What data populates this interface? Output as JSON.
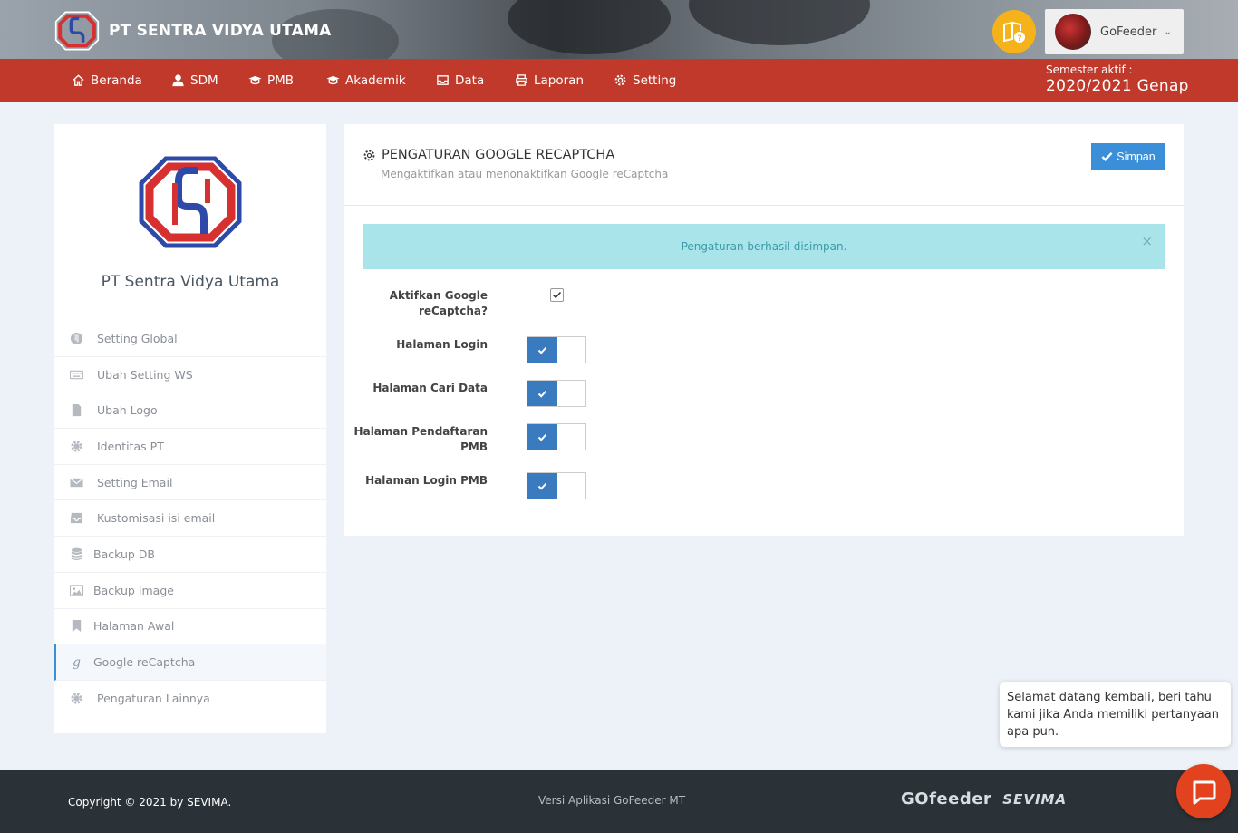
{
  "header": {
    "brand_name": "PT SENTRA VIDYA UTAMA",
    "user_name": "GoFeeder",
    "semester_label": "Semester aktif :",
    "semester_value": "2020/2021 Genap"
  },
  "nav": {
    "items": [
      {
        "label": "Beranda",
        "icon": "home-icon"
      },
      {
        "label": "SDM",
        "icon": "user-icon"
      },
      {
        "label": "PMB",
        "icon": "graduation-cap-icon"
      },
      {
        "label": "Akademik",
        "icon": "graduation-cap-icon"
      },
      {
        "label": "Data",
        "icon": "inbox-icon"
      },
      {
        "label": "Laporan",
        "icon": "printer-icon"
      },
      {
        "label": "Setting",
        "icon": "gear-icon"
      }
    ]
  },
  "sidebar": {
    "title": "PT Sentra Vidya Utama",
    "items": [
      {
        "label": "Setting Global",
        "icon": "globe-icon"
      },
      {
        "label": "Ubah Setting WS",
        "icon": "keyboard-icon"
      },
      {
        "label": "Ubah Logo",
        "icon": "file-icon"
      },
      {
        "label": "Identitas PT",
        "icon": "gear-icon"
      },
      {
        "label": "Setting Email",
        "icon": "envelope-icon"
      },
      {
        "label": "Kustomisasi isi email",
        "icon": "inbox-icon"
      },
      {
        "label": "Backup DB",
        "icon": "database-icon"
      },
      {
        "label": "Backup Image",
        "icon": "image-icon"
      },
      {
        "label": "Halaman Awal",
        "icon": "bookmark-icon"
      },
      {
        "label": "Google reCaptcha",
        "icon": "google-icon"
      },
      {
        "label": "Pengaturan Lainnya",
        "icon": "gear-icon"
      }
    ],
    "active": "Google reCaptcha"
  },
  "panel": {
    "title": "PENGATURAN GOOGLE RECAPTCHA",
    "subtitle": "Mengaktifkan atau menonaktifkan Google reCaptcha",
    "save_label": "Simpan",
    "alert": "Pengaturan berhasil disimpan.",
    "alert_close": "×",
    "fields": {
      "enable_line1": "Aktifkan Google",
      "enable_line2": "reCaptcha?",
      "login": "Halaman Login",
      "search": "Halaman Cari Data",
      "pmb_reg_line1": "Halaman Pendaftaran",
      "pmb_reg_line2": "PMB",
      "pmb_login": "Halaman Login PMB"
    }
  },
  "footer": {
    "copyright": "Copyright © 2021 by SEVIMA.",
    "version": "Versi Aplikasi GoFeeder MT",
    "logo_go": "GOfeeder",
    "logo_sevima": "SEVIMA"
  },
  "chat": {
    "message": "Selamat datang kembali, beri tahu kami jika Anda memiliki pertanyaan apa pun."
  },
  "colors": {
    "nav_bg": "#c0392b",
    "accent_blue": "#3a8fd8",
    "toggle_on": "#3a7bbf",
    "alert_bg": "#a8e4ea",
    "help_yellow": "#f6b21a",
    "chat_orange": "#e2421d",
    "footer_bg": "#2b3237"
  }
}
